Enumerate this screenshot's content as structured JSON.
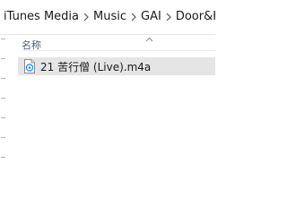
{
  "breadcrumb": {
    "items": [
      {
        "label": "iTunes Media"
      },
      {
        "label": "Music"
      },
      {
        "label": "GAI"
      },
      {
        "label": "Door&Ke"
      }
    ],
    "separator_icon": "chevron-right-icon"
  },
  "columns": {
    "name_header": "名称",
    "sort_icon": "chevron-up-icon"
  },
  "files": [
    {
      "name": "21 苦行僧 (Live).m4a",
      "icon": "audio-file-icon",
      "selected": true
    }
  ],
  "colors": {
    "selected_row": "#e5e5e5",
    "header_text": "#4c607a",
    "icon_accent": "#1e88e5"
  }
}
